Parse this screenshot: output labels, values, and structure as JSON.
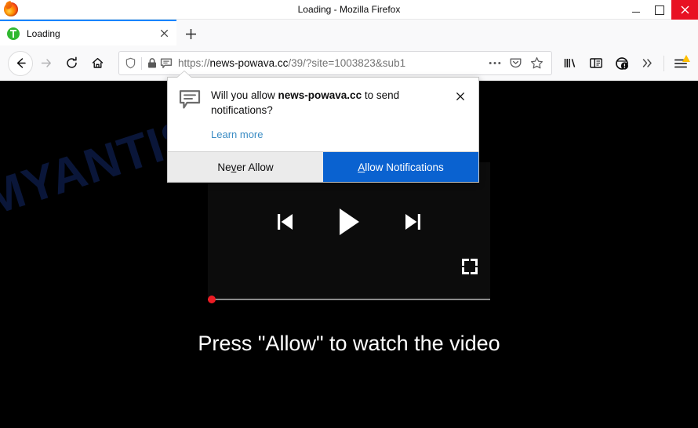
{
  "window": {
    "title": "Loading - Mozilla Firefox",
    "logo_icon": "firefox-logo-icon",
    "controls": {
      "minimize_label": "minimize",
      "maximize_label": "maximize",
      "close_label": "close"
    }
  },
  "tabs": {
    "items": [
      {
        "label": "Loading",
        "favicon_icon": "green-page-favicon",
        "close_icon": "close-icon"
      }
    ],
    "new_tab_label": "+"
  },
  "navbar": {
    "back_icon": "back-arrow-icon",
    "forward_icon": "forward-arrow-icon",
    "reload_icon": "reload-icon",
    "home_icon": "home-icon",
    "urlbar": {
      "shield_icon": "tracking-protection-shield-icon",
      "lock_icon": "padlock-icon",
      "notification_icon": "notification-bubble-icon",
      "scheme": "https://",
      "host": "news-powava.cc",
      "path": "/39/?site=1003823&sub1",
      "full_url": "https://news-powava.cc/39/?site=1003823&sub1",
      "page_actions_icon": "ellipsis-icon",
      "pocket_icon": "pocket-icon",
      "bookmark_icon": "star-icon"
    },
    "library_icon": "library-icon",
    "sidebar_icon": "sidebar-icon",
    "account_icon": "account-warning-icon",
    "overflow_icon": "double-chevron-icon",
    "menu_icon": "hamburger-menu-icon"
  },
  "doorhanger": {
    "icon": "notification-bubble-icon",
    "message_prefix": "Will you allow ",
    "message_host": "news-powava.cc",
    "message_suffix": " to send notifications?",
    "learn_more": "Learn more",
    "close_icon": "close-icon",
    "never_allow": {
      "accesskey": "v",
      "before": "Ne",
      "after": "er Allow"
    },
    "allow": {
      "accesskey": "A",
      "before": "",
      "after": "llow Notifications"
    },
    "primary_color": "#0a62d0"
  },
  "page": {
    "watermark": "MYANTISPYWARE.COM",
    "watermark_color": "#11255c",
    "background_color": "#000000",
    "player": {
      "prev_icon": "skip-previous-icon",
      "play_icon": "play-icon",
      "next_icon": "skip-next-icon",
      "fullscreen_icon": "fullscreen-icon",
      "progress_percent": 0,
      "knob_color": "#ed1c24"
    },
    "cta_text": "Press \"Allow\" to watch the video"
  }
}
